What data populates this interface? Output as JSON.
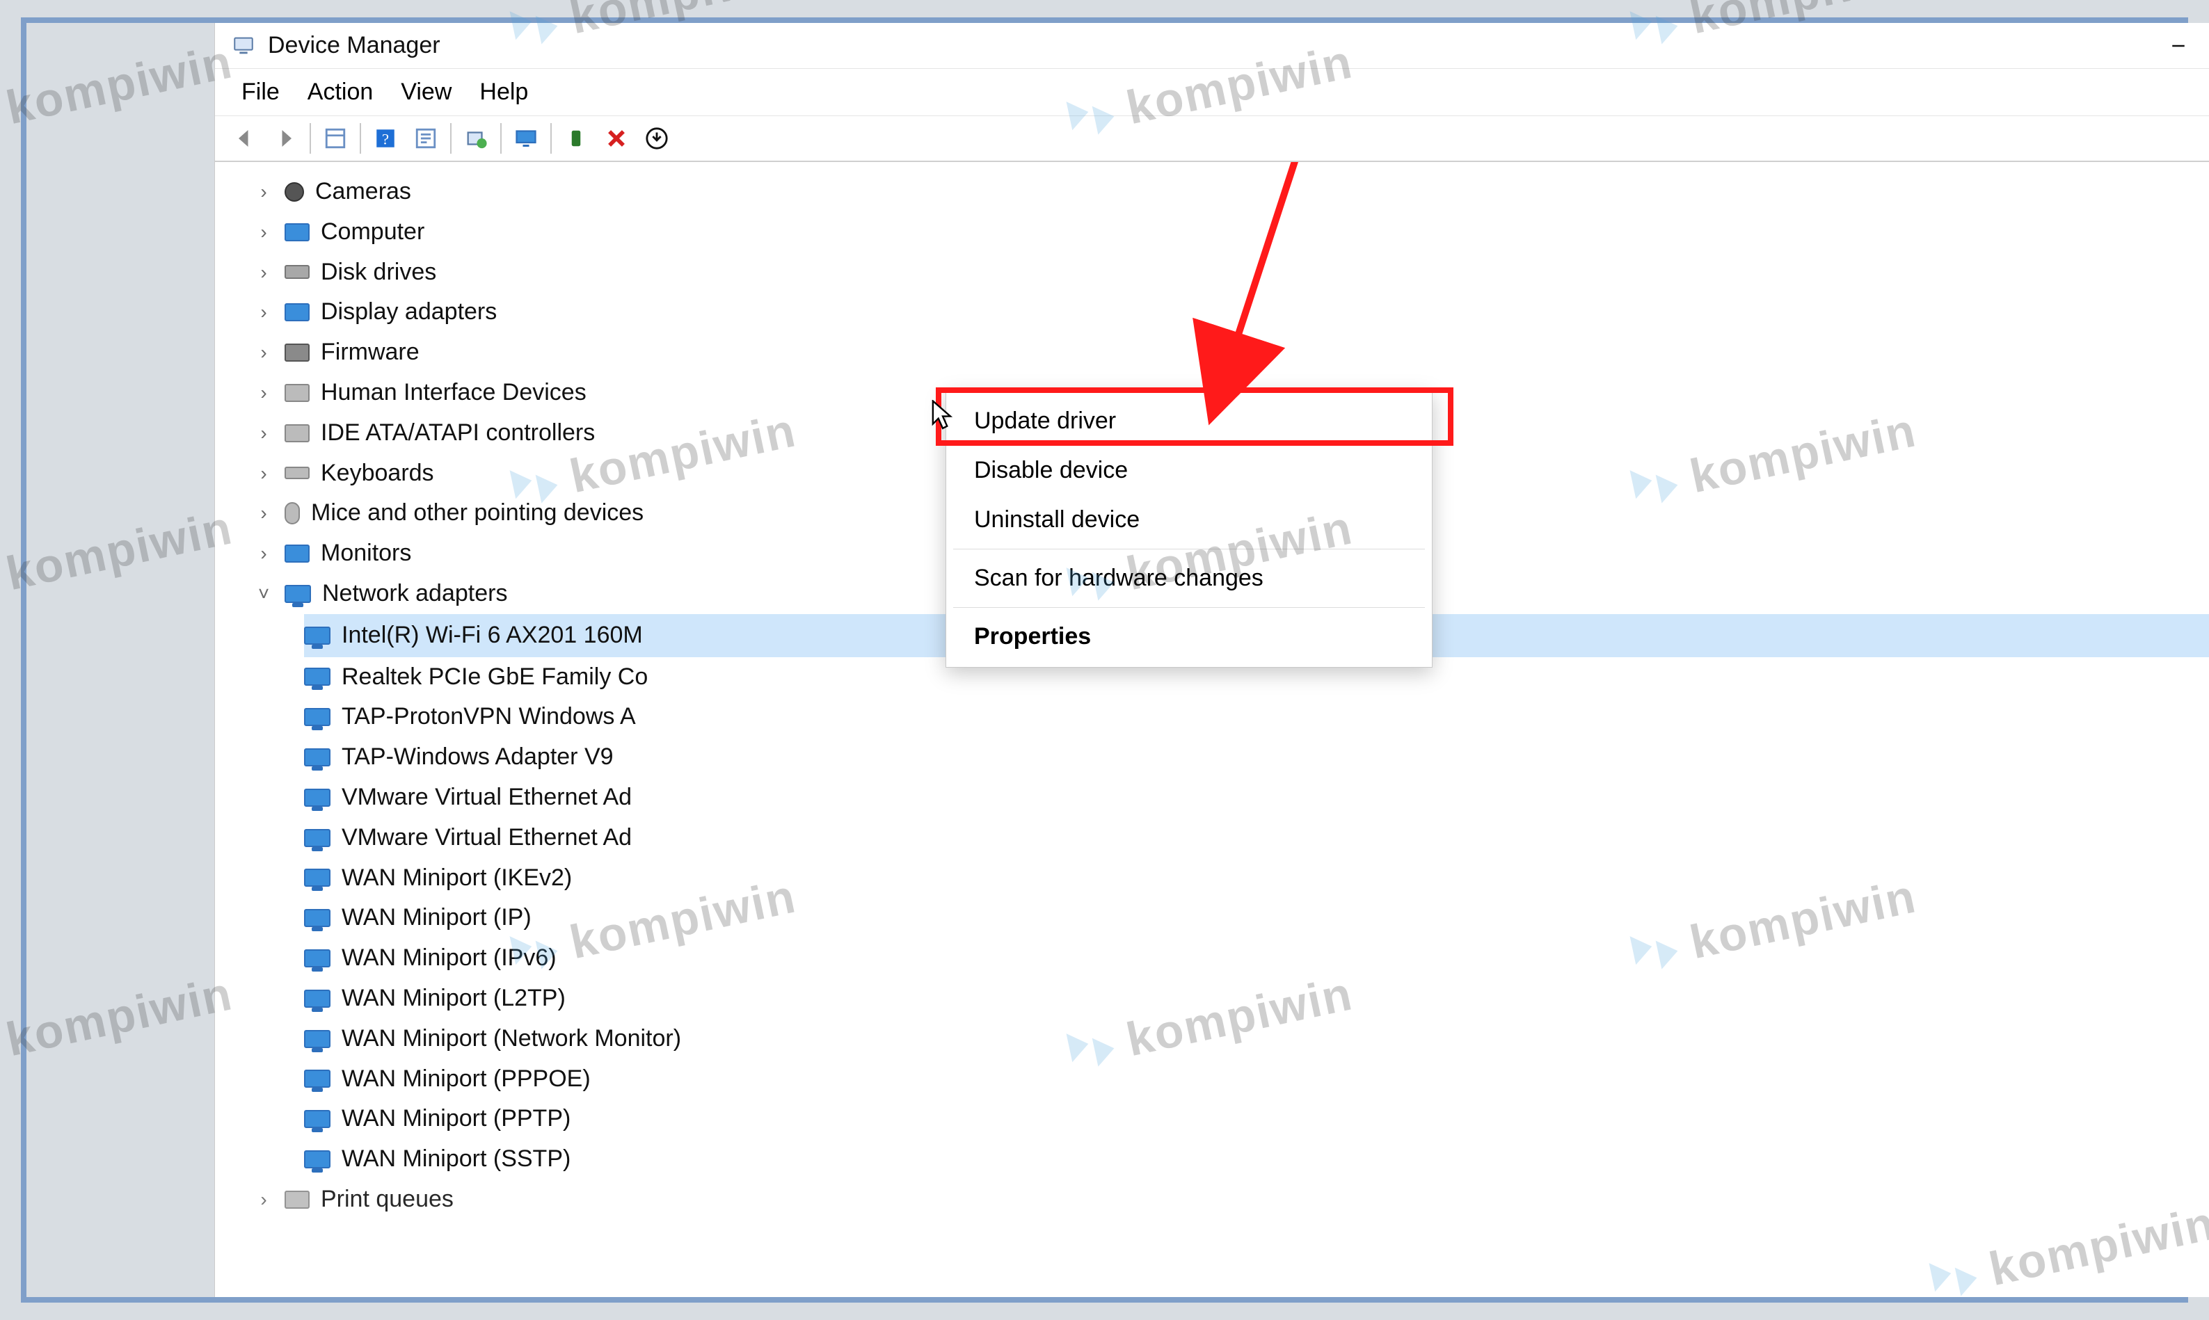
{
  "watermark_text": "kompiwin",
  "titlebar": {
    "title": "Device Manager"
  },
  "menubar": {
    "items": [
      "File",
      "Action",
      "View",
      "Help"
    ]
  },
  "tree": {
    "categories": [
      {
        "name": "Cameras",
        "expanded": false
      },
      {
        "name": "Computer",
        "expanded": false
      },
      {
        "name": "Disk drives",
        "expanded": false
      },
      {
        "name": "Display adapters",
        "expanded": false
      },
      {
        "name": "Firmware",
        "expanded": false
      },
      {
        "name": "Human Interface Devices",
        "expanded": false
      },
      {
        "name": "IDE ATA/ATAPI controllers",
        "expanded": false
      },
      {
        "name": "Keyboards",
        "expanded": false
      },
      {
        "name": "Mice and other pointing devices",
        "expanded": false
      },
      {
        "name": "Monitors",
        "expanded": false
      },
      {
        "name": "Network adapters",
        "expanded": true
      },
      {
        "name": "Print queues",
        "expanded": false,
        "truncated": true
      }
    ],
    "network_adapters": [
      {
        "label": "Intel(R) Wi-Fi 6 AX201 160M",
        "selected": true,
        "truncated": true
      },
      {
        "label": "Realtek PCIe GbE Family Co",
        "truncated": true
      },
      {
        "label": "TAP-ProtonVPN Windows A",
        "truncated": true
      },
      {
        "label": "TAP-Windows Adapter V9"
      },
      {
        "label": "VMware Virtual Ethernet Ad",
        "truncated": true
      },
      {
        "label": "VMware Virtual Ethernet Ad",
        "truncated": true
      },
      {
        "label": "WAN Miniport (IKEv2)"
      },
      {
        "label": "WAN Miniport (IP)"
      },
      {
        "label": "WAN Miniport (IPv6)"
      },
      {
        "label": "WAN Miniport (L2TP)"
      },
      {
        "label": "WAN Miniport (Network Monitor)"
      },
      {
        "label": "WAN Miniport (PPPOE)"
      },
      {
        "label": "WAN Miniport (PPTP)"
      },
      {
        "label": "WAN Miniport (SSTP)"
      }
    ]
  },
  "context_menu": {
    "items": [
      {
        "label": "Update driver",
        "highlighted": true
      },
      {
        "label": "Disable device"
      },
      {
        "label": "Uninstall device"
      },
      {
        "separator": true
      },
      {
        "label": "Scan for hardware changes"
      },
      {
        "separator": true
      },
      {
        "label": "Properties",
        "bold": true
      }
    ]
  },
  "toolbar_icons": [
    "back-arrow-icon",
    "forward-arrow-icon",
    "sep",
    "properties-pane-icon",
    "sep",
    "help-icon",
    "refresh-icon",
    "sep",
    "scan-hardware-icon",
    "sep",
    "monitor-icon",
    "sep",
    "enable-device-icon",
    "disable-device-icon",
    "uninstall-icon"
  ],
  "annotation": {
    "arrow_color": "#ff1a1a",
    "highlight_target": "Update driver"
  }
}
